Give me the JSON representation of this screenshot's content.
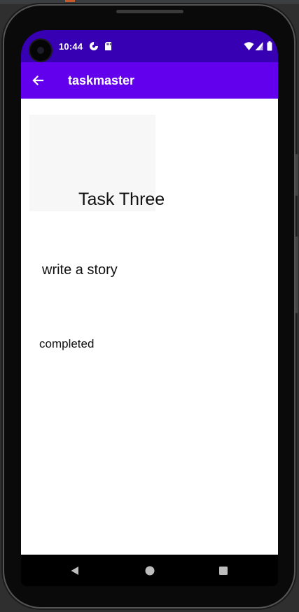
{
  "status_bar": {
    "time": "10:44",
    "background": "#3700b3",
    "icons": [
      "data-saver-icon",
      "sd-card-icon",
      "wifi-icon",
      "cell-signal-icon",
      "battery-icon"
    ]
  },
  "app_bar": {
    "title": "taskmaster",
    "background": "#6200ee",
    "back_icon": "arrow-back-icon"
  },
  "task": {
    "title": "Task Three",
    "body": "write a story",
    "state": "completed"
  },
  "nav_bar": {
    "icons": [
      "back-triangle-icon",
      "home-circle-icon",
      "recents-square-icon"
    ]
  }
}
